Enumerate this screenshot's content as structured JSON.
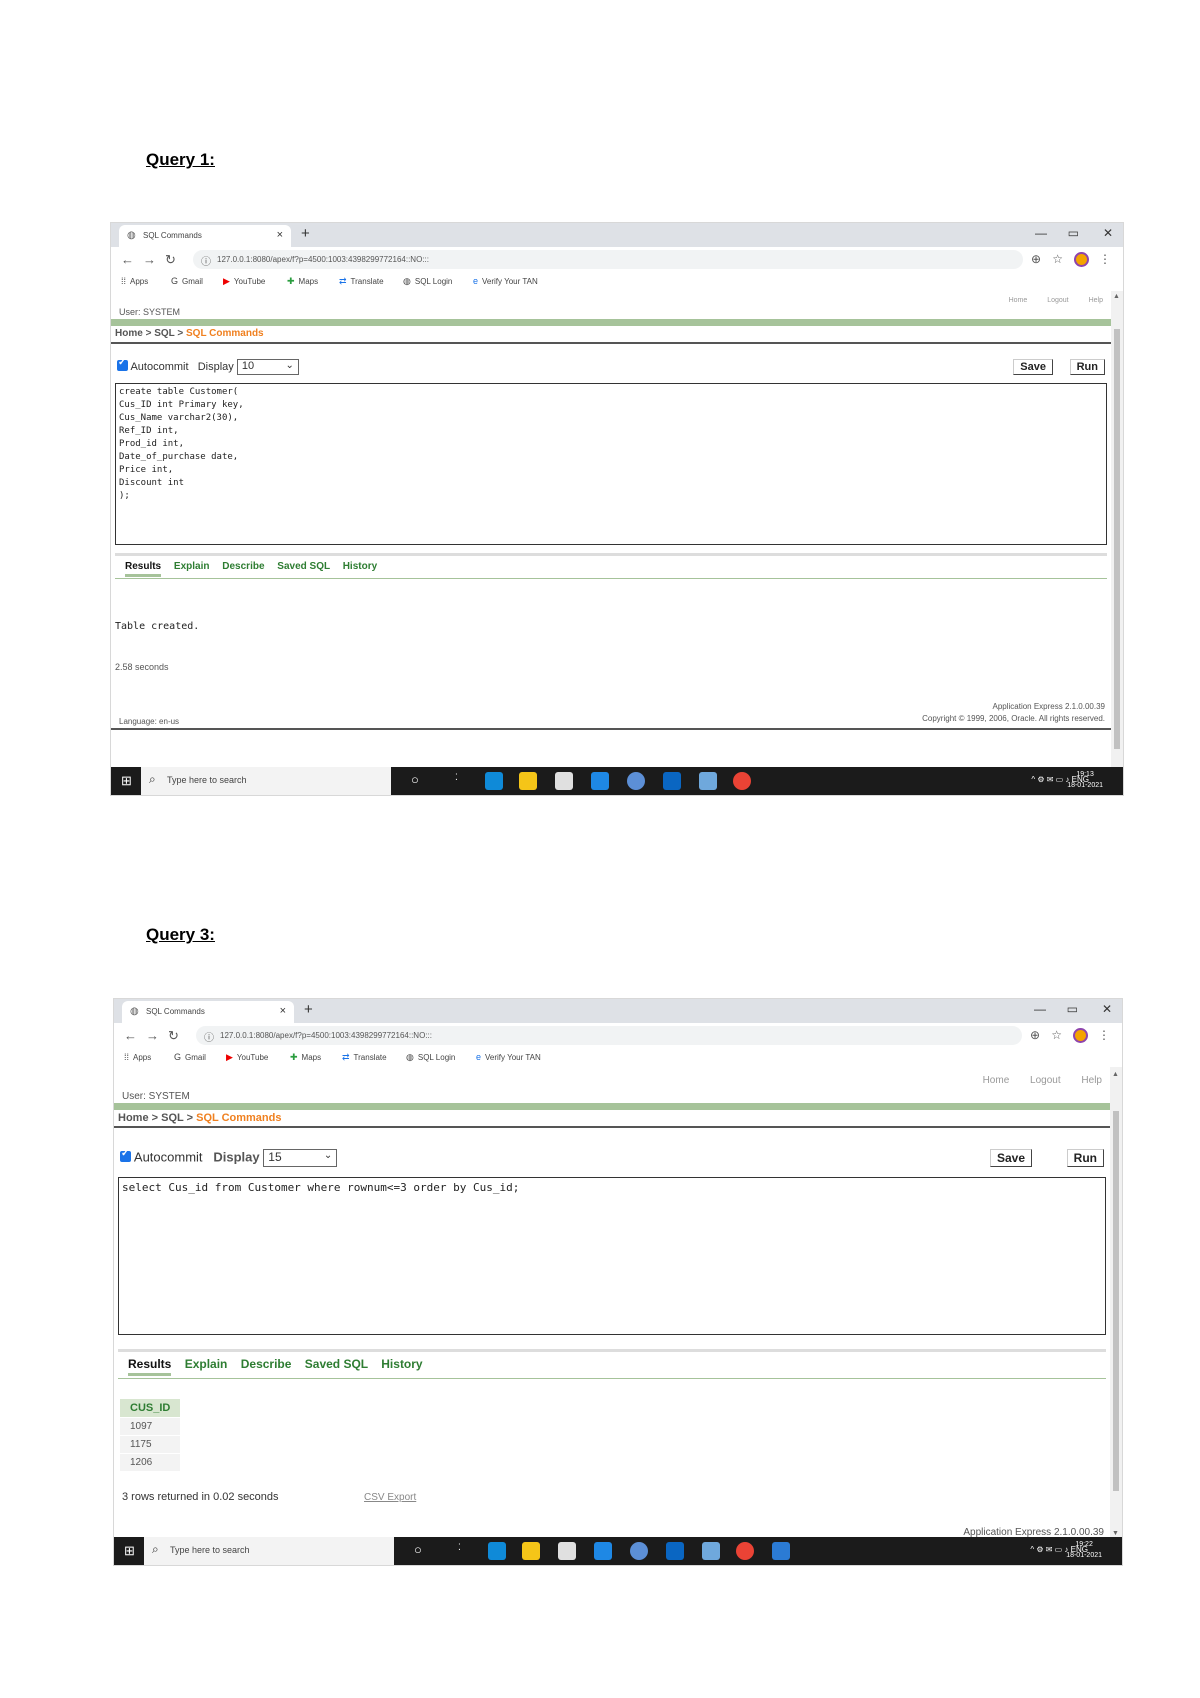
{
  "headings": {
    "q1": "Query 1:",
    "q3": "Query 3:"
  },
  "browser": {
    "tab_title": "SQL Commands",
    "url": "127.0.0.1:8080/apex/f?p=4500:1003:4398299772164::NO:::",
    "bookmarks": [
      "Apps",
      "Gmail",
      "YouTube",
      "Maps",
      "Translate",
      "SQL Login",
      "Verify Your TAN"
    ]
  },
  "apex": {
    "top_links": [
      "Home",
      "Logout",
      "Help"
    ],
    "user": "User: SYSTEM",
    "breadcrumb": {
      "home": "Home",
      "sep": ">",
      "sql": "SQL",
      "current": "SQL Commands"
    },
    "autocommit_label": "Autocommit",
    "display_label": "Display",
    "save_label": "Save",
    "run_label": "Run",
    "result_tabs": [
      "Results",
      "Explain",
      "Describe",
      "Saved SQL",
      "History"
    ],
    "language": "Language: en-us",
    "version": "Application Express 2.1.0.00.39",
    "copyright": "Copyright © 1999, 2006, Oracle. All rights reserved."
  },
  "taskbar": {
    "search_placeholder": "Type here to search",
    "lang": "ENG",
    "time1": "19:13",
    "date1": "18-01-2021",
    "time3": "19:22",
    "date3": "18-01-2021"
  },
  "query1": {
    "display_value": "10",
    "sql": "create table Customer(\nCus_ID int Primary key,\nCus_Name varchar2(30),\nRef_ID int,\nProd_id int,\nDate_of_purchase date,\nPrice int,\nDiscount int\n);",
    "result": "Table created.",
    "timing": "2.58 seconds"
  },
  "query3": {
    "display_value": "15",
    "sql": "select Cus_id from Customer where rownum<=3 order by Cus_id;",
    "column": "CUS_ID",
    "rows": [
      "1097",
      "1175",
      "1206"
    ],
    "summary": "3 rows returned in 0.02 seconds",
    "csv": "CSV Export"
  },
  "colors": {
    "accent_green": "#a6c39a",
    "breadcrumb_orange": "#f08020",
    "tab_green": "#2e7d32"
  }
}
